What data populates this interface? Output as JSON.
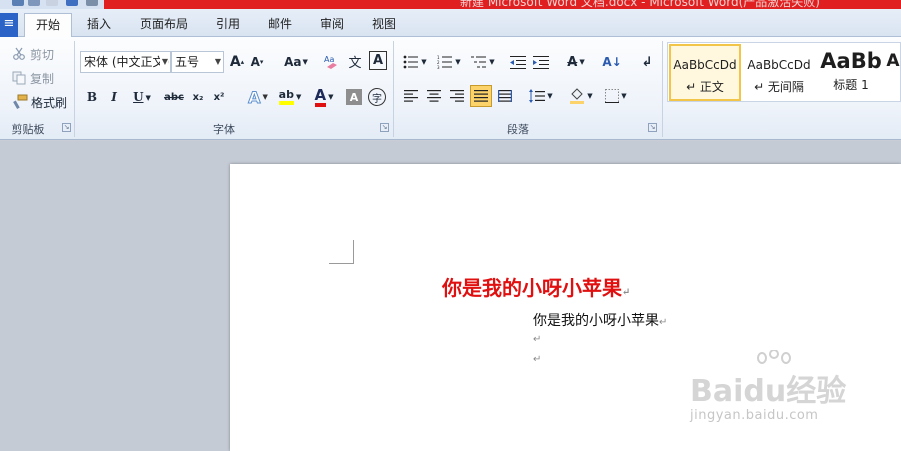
{
  "titlebar": {
    "title": "新建 Microsoft Word 文档.docx - Microsoft Word(产品激活失败)"
  },
  "tabs": {
    "file": "≡",
    "items": [
      "开始",
      "插入",
      "页面布局",
      "引用",
      "邮件",
      "审阅",
      "视图"
    ],
    "active": "开始"
  },
  "clipboard": {
    "cut": "剪切",
    "copy": "复制",
    "format_painter": "格式刷",
    "group_label": "剪贴板"
  },
  "font": {
    "font_name": "宋体 (中文正文)",
    "font_size": "五号",
    "grow": "A",
    "shrink": "A",
    "change_case": "Aa",
    "bold": "B",
    "italic": "I",
    "underline": "U",
    "strikethrough": "abc",
    "subscript": "x₂",
    "superscript": "x²",
    "text_effect": "A",
    "highlight": "ab",
    "font_color": "A",
    "char_shading": "A",
    "enclose": "字",
    "phonetic": "文",
    "char_border": "A",
    "group_label": "字体"
  },
  "paragraph": {
    "group_label": "段落",
    "chinese_layout": "A",
    "sort": "A↓"
  },
  "styles": {
    "items": [
      {
        "sample": "AaBbCcDd",
        "name": "↵ 正文"
      },
      {
        "sample": "AaBbCcDd",
        "name": "↵ 无间隔"
      },
      {
        "sample": "AaBb",
        "name": "标题 1"
      },
      {
        "sample": "A",
        "name": ""
      }
    ]
  },
  "document": {
    "title": "你是我的小呀小苹果",
    "line1": "你是我的小呀小苹果",
    "para_mark": "↵"
  },
  "watermark": {
    "brand": "Baidu经验",
    "url": "jingyan.baidu.com"
  },
  "colors": {
    "title_red": "#e01010",
    "highlight_yellow": "#ffff00",
    "font_color_red": "#e01010",
    "selected_style_border": "#f2c548",
    "file_tab_blue": "#2b64c6",
    "titlebar_red": "#e02020"
  },
  "icons": {
    "cut": "scissors-icon",
    "copy": "copy-icon",
    "format_painter": "paintbrush-icon",
    "bullets": "bullet-list-icon",
    "numbering": "numbered-list-icon",
    "multilevel": "multilevel-list-icon",
    "align_left": "align-left-icon",
    "align_center": "align-center-icon",
    "align_right": "align-right-icon",
    "justify": "justify-icon",
    "distribute": "distribute-icon",
    "line_spacing": "line-spacing-icon",
    "shading": "paint-bucket-icon",
    "borders": "borders-icon",
    "show_marks": "pilcrow-icon"
  }
}
